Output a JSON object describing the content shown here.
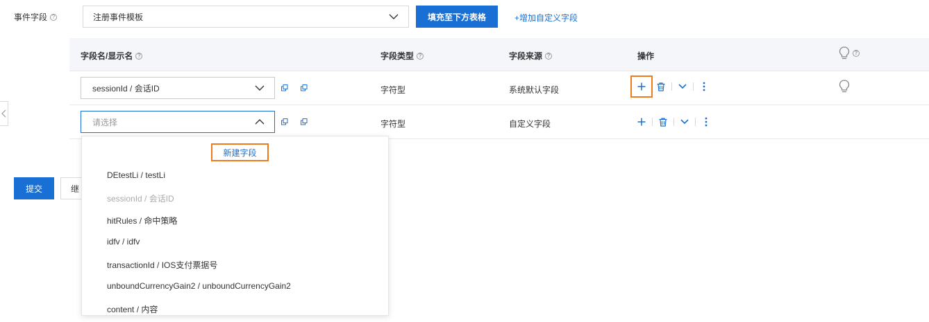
{
  "top": {
    "label": "事件字段",
    "template_select_value": "注册事件模板",
    "fill_button": "填充至下方表格",
    "add_custom_link": "+增加自定义字段"
  },
  "table": {
    "headers": {
      "name": "字段名/显示名",
      "type": "字段类型",
      "source": "字段来源",
      "ops": "操作"
    },
    "rows": [
      {
        "field": "sessionId / 会话ID",
        "type": "字符型",
        "source": "系统默认字段"
      },
      {
        "field_placeholder": "请选择",
        "type": "字符型",
        "source": "自定义字段"
      }
    ]
  },
  "dropdown": {
    "new_field": "新建字段",
    "items": [
      {
        "label": "DEtestLi / testLi",
        "disabled": false
      },
      {
        "label": "sessionId / 会话ID",
        "disabled": true
      },
      {
        "label": "hitRules / 命中策略",
        "disabled": false
      },
      {
        "label": "idfv / idfv",
        "disabled": false
      },
      {
        "label": "transactionId / IOS支付票据号",
        "disabled": false
      },
      {
        "label": "unboundCurrencyGain2 / unboundCurrencyGain2",
        "disabled": false
      },
      {
        "label": "content / 内容",
        "disabled": false
      }
    ]
  },
  "footer": {
    "submit": "提交",
    "continue": "继"
  },
  "colors": {
    "primary": "#1a6fd4",
    "highlight": "#f07a1a",
    "header_bg": "#f4f6f9"
  },
  "icons": [
    "help-icon",
    "chevron-down-icon",
    "chevron-up-icon",
    "copy-icon",
    "plus-icon",
    "trash-icon",
    "more-vertical-icon",
    "lightbulb-icon",
    "chevron-left-icon"
  ]
}
